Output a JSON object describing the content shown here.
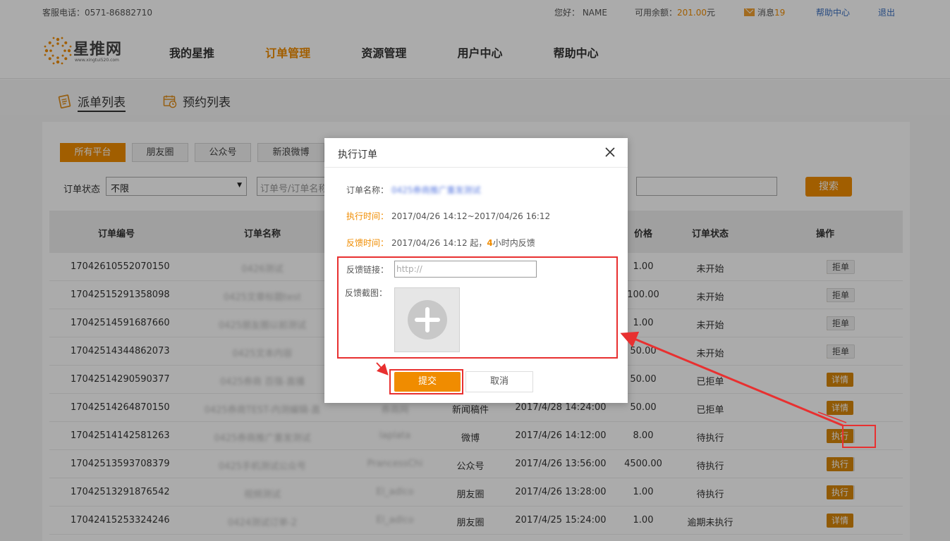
{
  "topbar": {
    "tel": "客服电话：0571-86882710",
    "hello": "您好： NAME",
    "balance_label": "可用余额：",
    "balance_value": "201.00",
    "balance_unit": "元",
    "msg_label": "消息",
    "msg_count": "19",
    "help": "帮助中心",
    "logout": "退出"
  },
  "logo": {
    "name": "星推网",
    "url": "www.xingtui520.com"
  },
  "nav": [
    "我的星推",
    "订单管理",
    "资源管理",
    "用户中心",
    "帮助中心"
  ],
  "nav_active": 1,
  "subtabs": [
    "派单列表",
    "预约列表"
  ],
  "platforms": [
    "所有平台",
    "朋友圈",
    "公众号",
    "新浪微博"
  ],
  "filter": {
    "status_label": "订单状态",
    "status_value": "不限",
    "order_placeholder": "订单号/订单名称",
    "search": "搜索"
  },
  "table": {
    "headers": [
      "订单编号",
      "订单名称",
      "价格",
      "订单状态",
      "操作"
    ],
    "ops": {
      "detail": "详情",
      "reject": "拒单",
      "exec": "执行"
    },
    "rows": [
      {
        "id": "17042610552070150",
        "name": "0426测试",
        "res": "",
        "plat": "",
        "time": "",
        "price": "1.00",
        "status": "未开始",
        "ops": [
          "detail",
          "reject"
        ]
      },
      {
        "id": "17042515291358098",
        "name": "0425文章标题test",
        "res": "",
        "plat": "",
        "time": "",
        "price": "100.00",
        "status": "未开始",
        "ops": [
          "detail",
          "reject"
        ]
      },
      {
        "id": "17042514591687660",
        "name": "0425朋友圈以前测试",
        "res": "",
        "plat": "",
        "time": "",
        "price": "1.00",
        "status": "未开始",
        "ops": [
          "detail",
          "reject"
        ]
      },
      {
        "id": "17042514344862073",
        "name": "0425文本内容",
        "res": "",
        "plat": "",
        "time": "",
        "price": "50.00",
        "status": "未开始",
        "ops": [
          "detail",
          "reject"
        ]
      },
      {
        "id": "17042514290590377",
        "name": "0425券商 百强-直播",
        "res": "",
        "plat": "",
        "time": "",
        "price": "50.00",
        "status": "已拒单",
        "ops": [
          "detail"
        ]
      },
      {
        "id": "17042514264870150",
        "name": "0425券商TEST-内测编辑-直",
        "res": "券商网",
        "plat": "新闻稿件",
        "time": "2017/4/28 14:24:00",
        "price": "50.00",
        "status": "已拒单",
        "ops": [
          "detail"
        ]
      },
      {
        "id": "17042514142581263",
        "name": "0425券商推广重发测试",
        "res": "laplata",
        "plat": "微博",
        "time": "2017/4/26 14:12:00",
        "price": "8.00",
        "status": "待执行",
        "ops": [
          "detail",
          "reject",
          "exec"
        ]
      },
      {
        "id": "17042513593708379",
        "name": "0425手机测试公众号",
        "res": "PrancessChi",
        "plat": "公众号",
        "time": "2017/4/26 13:56:00",
        "price": "4500.00",
        "status": "待执行",
        "ops": [
          "detail",
          "reject",
          "exec"
        ]
      },
      {
        "id": "17042513291876542",
        "name": "视频测试",
        "res": "El_adlco",
        "plat": "朋友圈",
        "time": "2017/4/26 13:28:00",
        "price": "1.00",
        "status": "待执行",
        "ops": [
          "detail",
          "reject",
          "exec"
        ]
      },
      {
        "id": "17042415253324246",
        "name": "0424测试订单-2",
        "res": "El_adlco",
        "plat": "朋友圈",
        "time": "2017/4/25 15:24:00",
        "price": "1.00",
        "status": "逾期未执行",
        "ops": [
          "detail"
        ]
      }
    ]
  },
  "modal": {
    "title": "执行订单",
    "order_name_label": "订单名称：",
    "order_name_value": "0425券商推广重发测试",
    "exec_time_label": "执行时间：",
    "exec_time_value": "2017/04/26 14:12~2017/04/26 16:12",
    "feedback_time_label": "反馈时间：",
    "feedback_time_value": "2017/04/26 14:12 起，",
    "feedback_hours": "4",
    "feedback_suffix": "小时内反馈",
    "link_label": "反馈链接：",
    "link_placeholder": "http://",
    "shot_label": "反馈截图：",
    "submit": "提交",
    "cancel": "取消"
  },
  "colors": {
    "accent": "#f08c00",
    "annotation": "#e83030",
    "link": "#3a6fc0"
  }
}
